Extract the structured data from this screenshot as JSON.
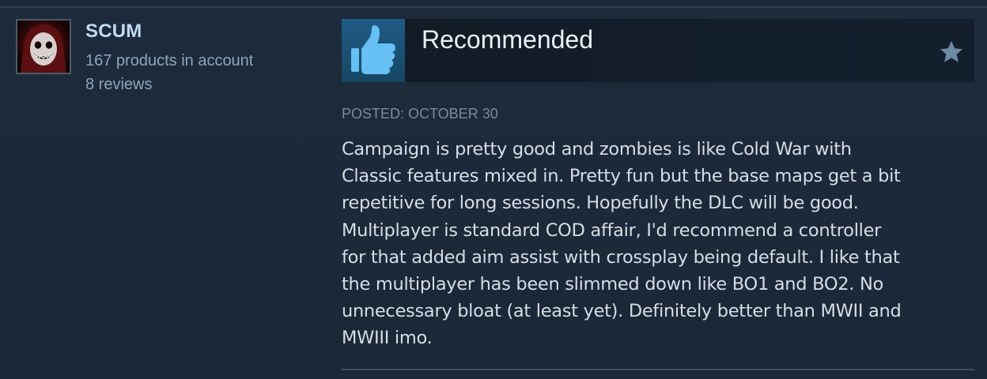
{
  "author": {
    "name": "SCUM",
    "products": "167 products in account",
    "reviews": "8 reviews",
    "avatar_icon": "red-hooded-grin-avatar"
  },
  "review": {
    "vote_label": "Recommended",
    "vote_icon": "thumbs-up-icon",
    "favorite_icon": "star-icon",
    "posted": "POSTED: OCTOBER 30",
    "body_lines": [
      "Campaign is pretty good and zombies is like Cold War with",
      "Classic features mixed in. Pretty fun but the base maps get a bit",
      "repetitive for long sessions. Hopefully the DLC will be good.",
      "Multiplayer is standard COD affair, I'd recommend a controller",
      "for that added aim assist with crossplay being default. I like that",
      "the multiplayer has been slimmed down like BO1 and BO2. No",
      "unnecessary bloat (at least yet). Definitely better than MWII and",
      "MWIII imo."
    ]
  },
  "colors": {
    "background": "#1b2838",
    "author_name": "#c1dbf4",
    "author_meta": "#8ba6bd",
    "thumb_blue": "#66c0f4",
    "body_text": "#d6dde4",
    "date_text": "#7a8b9c"
  }
}
